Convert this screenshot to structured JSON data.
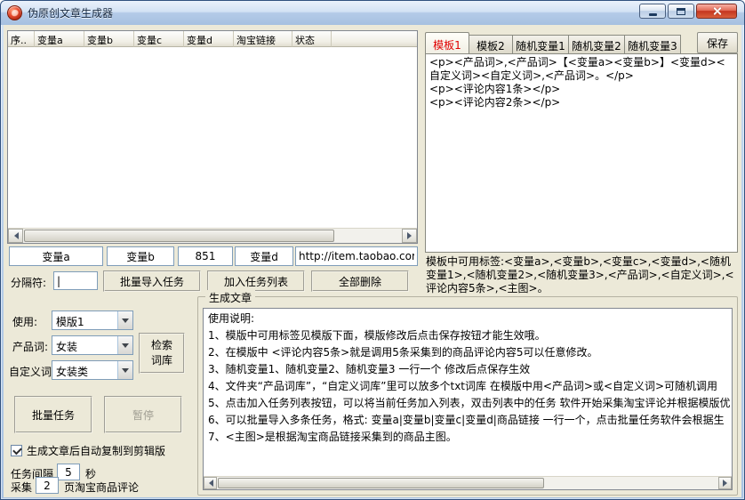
{
  "window": {
    "title": "伪原创文章生成器"
  },
  "table": {
    "columns": [
      "序..",
      "变量a",
      "变量b",
      "变量c",
      "变量d",
      "淘宝链接",
      "状态"
    ],
    "rows": []
  },
  "task_bar": {
    "var_a_value": "变量a",
    "var_b_value": "变量b",
    "var_c_value": "851",
    "var_d_value": "变量d",
    "link_value": "http://item.taobao.com,",
    "separator_label": "分隔符:",
    "separator_value": "|",
    "batch_import": "批量导入任务",
    "add_to_list": "加入任务列表",
    "delete_all": "全部删除"
  },
  "settings": {
    "use_label": "使用:",
    "use_value": "模版1",
    "product_label": "产品词:",
    "product_value": "女装",
    "search_lexicon": "检索词库",
    "custom_label": "自定义词:",
    "custom_value": "女装类",
    "batch_task": "批量任务",
    "pause": "暂停",
    "auto_copy": "生成文章后自动复制到剪辑版",
    "interval_label": "任务间隔",
    "interval_value": "5",
    "interval_unit": "秒",
    "collect_label": "采集",
    "collect_value": "2",
    "collect_unit": "页淘宝商品评论"
  },
  "template": {
    "tabs": [
      "模板1",
      "模板2",
      "随机变量1",
      "随机变量2",
      "随机变量3"
    ],
    "save": "保存",
    "content": "<p><产品词>,<产品词>【<变量a><变量b>】<变量d><自定义词><自定义词>,<产品词>。</p>\n<p><评论内容1条></p>\n<p><评论内容2条></p>",
    "tags_hint": "模板中可用标签:<变量a>,<变量b>,<变量c>,<变量d>,<随机变量1>,<随机变量2>,<随机变量3>,<产品词>,<自定义词>,<评论内容5条>,<主图>。"
  },
  "generate": {
    "group_title": "生成文章",
    "lines": [
      "使用说明:",
      "1、模版中可用标签见模版下面，模版修改后点击保存按钮才能生效哦。",
      "2、在模版中 <评论内容5条>就是调用5条采集到的商品评论内容5可以任意修改。",
      "3、随机变量1、随机变量2、随机变量3  一行一个  修改后点保存生效",
      "4、文件夹“产品词库”，“自定义词库”里可以放多个txt词库 在模版中用<产品词>或<自定义词>可随机调用",
      "5、点击加入任务列表按钮，可以将当前任务加入列表，双击列表中的任务 软件开始采集淘宝评论并根据模版优",
      "6、可以批量导入多条任务，格式: 变量a|变量b|变量c|变量d|商品链接  一行一个，点击批量任务软件会根据生",
      "7、<主图>是根据淘宝商品链接采集到的商品主图。"
    ]
  }
}
